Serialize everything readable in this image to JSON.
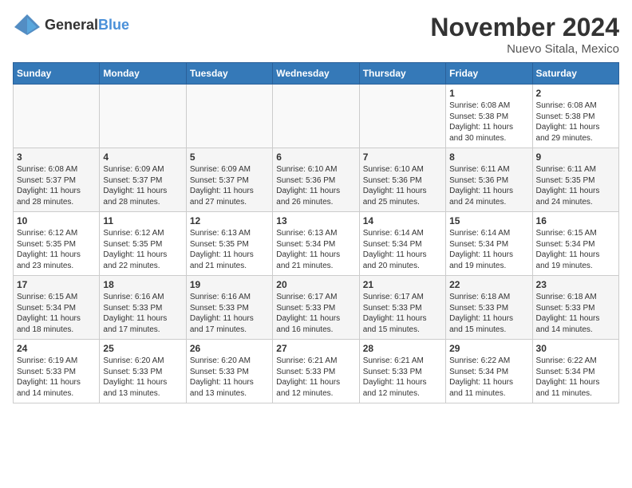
{
  "logo": {
    "general": "General",
    "blue": "Blue"
  },
  "header": {
    "month": "November 2024",
    "location": "Nuevo Sitala, Mexico"
  },
  "weekdays": [
    "Sunday",
    "Monday",
    "Tuesday",
    "Wednesday",
    "Thursday",
    "Friday",
    "Saturday"
  ],
  "weeks": [
    [
      {
        "day": "",
        "info": ""
      },
      {
        "day": "",
        "info": ""
      },
      {
        "day": "",
        "info": ""
      },
      {
        "day": "",
        "info": ""
      },
      {
        "day": "",
        "info": ""
      },
      {
        "day": "1",
        "info": "Sunrise: 6:08 AM\nSunset: 5:38 PM\nDaylight: 11 hours\nand 30 minutes."
      },
      {
        "day": "2",
        "info": "Sunrise: 6:08 AM\nSunset: 5:38 PM\nDaylight: 11 hours\nand 29 minutes."
      }
    ],
    [
      {
        "day": "3",
        "info": "Sunrise: 6:08 AM\nSunset: 5:37 PM\nDaylight: 11 hours\nand 28 minutes."
      },
      {
        "day": "4",
        "info": "Sunrise: 6:09 AM\nSunset: 5:37 PM\nDaylight: 11 hours\nand 28 minutes."
      },
      {
        "day": "5",
        "info": "Sunrise: 6:09 AM\nSunset: 5:37 PM\nDaylight: 11 hours\nand 27 minutes."
      },
      {
        "day": "6",
        "info": "Sunrise: 6:10 AM\nSunset: 5:36 PM\nDaylight: 11 hours\nand 26 minutes."
      },
      {
        "day": "7",
        "info": "Sunrise: 6:10 AM\nSunset: 5:36 PM\nDaylight: 11 hours\nand 25 minutes."
      },
      {
        "day": "8",
        "info": "Sunrise: 6:11 AM\nSunset: 5:36 PM\nDaylight: 11 hours\nand 24 minutes."
      },
      {
        "day": "9",
        "info": "Sunrise: 6:11 AM\nSunset: 5:35 PM\nDaylight: 11 hours\nand 24 minutes."
      }
    ],
    [
      {
        "day": "10",
        "info": "Sunrise: 6:12 AM\nSunset: 5:35 PM\nDaylight: 11 hours\nand 23 minutes."
      },
      {
        "day": "11",
        "info": "Sunrise: 6:12 AM\nSunset: 5:35 PM\nDaylight: 11 hours\nand 22 minutes."
      },
      {
        "day": "12",
        "info": "Sunrise: 6:13 AM\nSunset: 5:35 PM\nDaylight: 11 hours\nand 21 minutes."
      },
      {
        "day": "13",
        "info": "Sunrise: 6:13 AM\nSunset: 5:34 PM\nDaylight: 11 hours\nand 21 minutes."
      },
      {
        "day": "14",
        "info": "Sunrise: 6:14 AM\nSunset: 5:34 PM\nDaylight: 11 hours\nand 20 minutes."
      },
      {
        "day": "15",
        "info": "Sunrise: 6:14 AM\nSunset: 5:34 PM\nDaylight: 11 hours\nand 19 minutes."
      },
      {
        "day": "16",
        "info": "Sunrise: 6:15 AM\nSunset: 5:34 PM\nDaylight: 11 hours\nand 19 minutes."
      }
    ],
    [
      {
        "day": "17",
        "info": "Sunrise: 6:15 AM\nSunset: 5:34 PM\nDaylight: 11 hours\nand 18 minutes."
      },
      {
        "day": "18",
        "info": "Sunrise: 6:16 AM\nSunset: 5:33 PM\nDaylight: 11 hours\nand 17 minutes."
      },
      {
        "day": "19",
        "info": "Sunrise: 6:16 AM\nSunset: 5:33 PM\nDaylight: 11 hours\nand 17 minutes."
      },
      {
        "day": "20",
        "info": "Sunrise: 6:17 AM\nSunset: 5:33 PM\nDaylight: 11 hours\nand 16 minutes."
      },
      {
        "day": "21",
        "info": "Sunrise: 6:17 AM\nSunset: 5:33 PM\nDaylight: 11 hours\nand 15 minutes."
      },
      {
        "day": "22",
        "info": "Sunrise: 6:18 AM\nSunset: 5:33 PM\nDaylight: 11 hours\nand 15 minutes."
      },
      {
        "day": "23",
        "info": "Sunrise: 6:18 AM\nSunset: 5:33 PM\nDaylight: 11 hours\nand 14 minutes."
      }
    ],
    [
      {
        "day": "24",
        "info": "Sunrise: 6:19 AM\nSunset: 5:33 PM\nDaylight: 11 hours\nand 14 minutes."
      },
      {
        "day": "25",
        "info": "Sunrise: 6:20 AM\nSunset: 5:33 PM\nDaylight: 11 hours\nand 13 minutes."
      },
      {
        "day": "26",
        "info": "Sunrise: 6:20 AM\nSunset: 5:33 PM\nDaylight: 11 hours\nand 13 minutes."
      },
      {
        "day": "27",
        "info": "Sunrise: 6:21 AM\nSunset: 5:33 PM\nDaylight: 11 hours\nand 12 minutes."
      },
      {
        "day": "28",
        "info": "Sunrise: 6:21 AM\nSunset: 5:33 PM\nDaylight: 11 hours\nand 12 minutes."
      },
      {
        "day": "29",
        "info": "Sunrise: 6:22 AM\nSunset: 5:34 PM\nDaylight: 11 hours\nand 11 minutes."
      },
      {
        "day": "30",
        "info": "Sunrise: 6:22 AM\nSunset: 5:34 PM\nDaylight: 11 hours\nand 11 minutes."
      }
    ]
  ]
}
